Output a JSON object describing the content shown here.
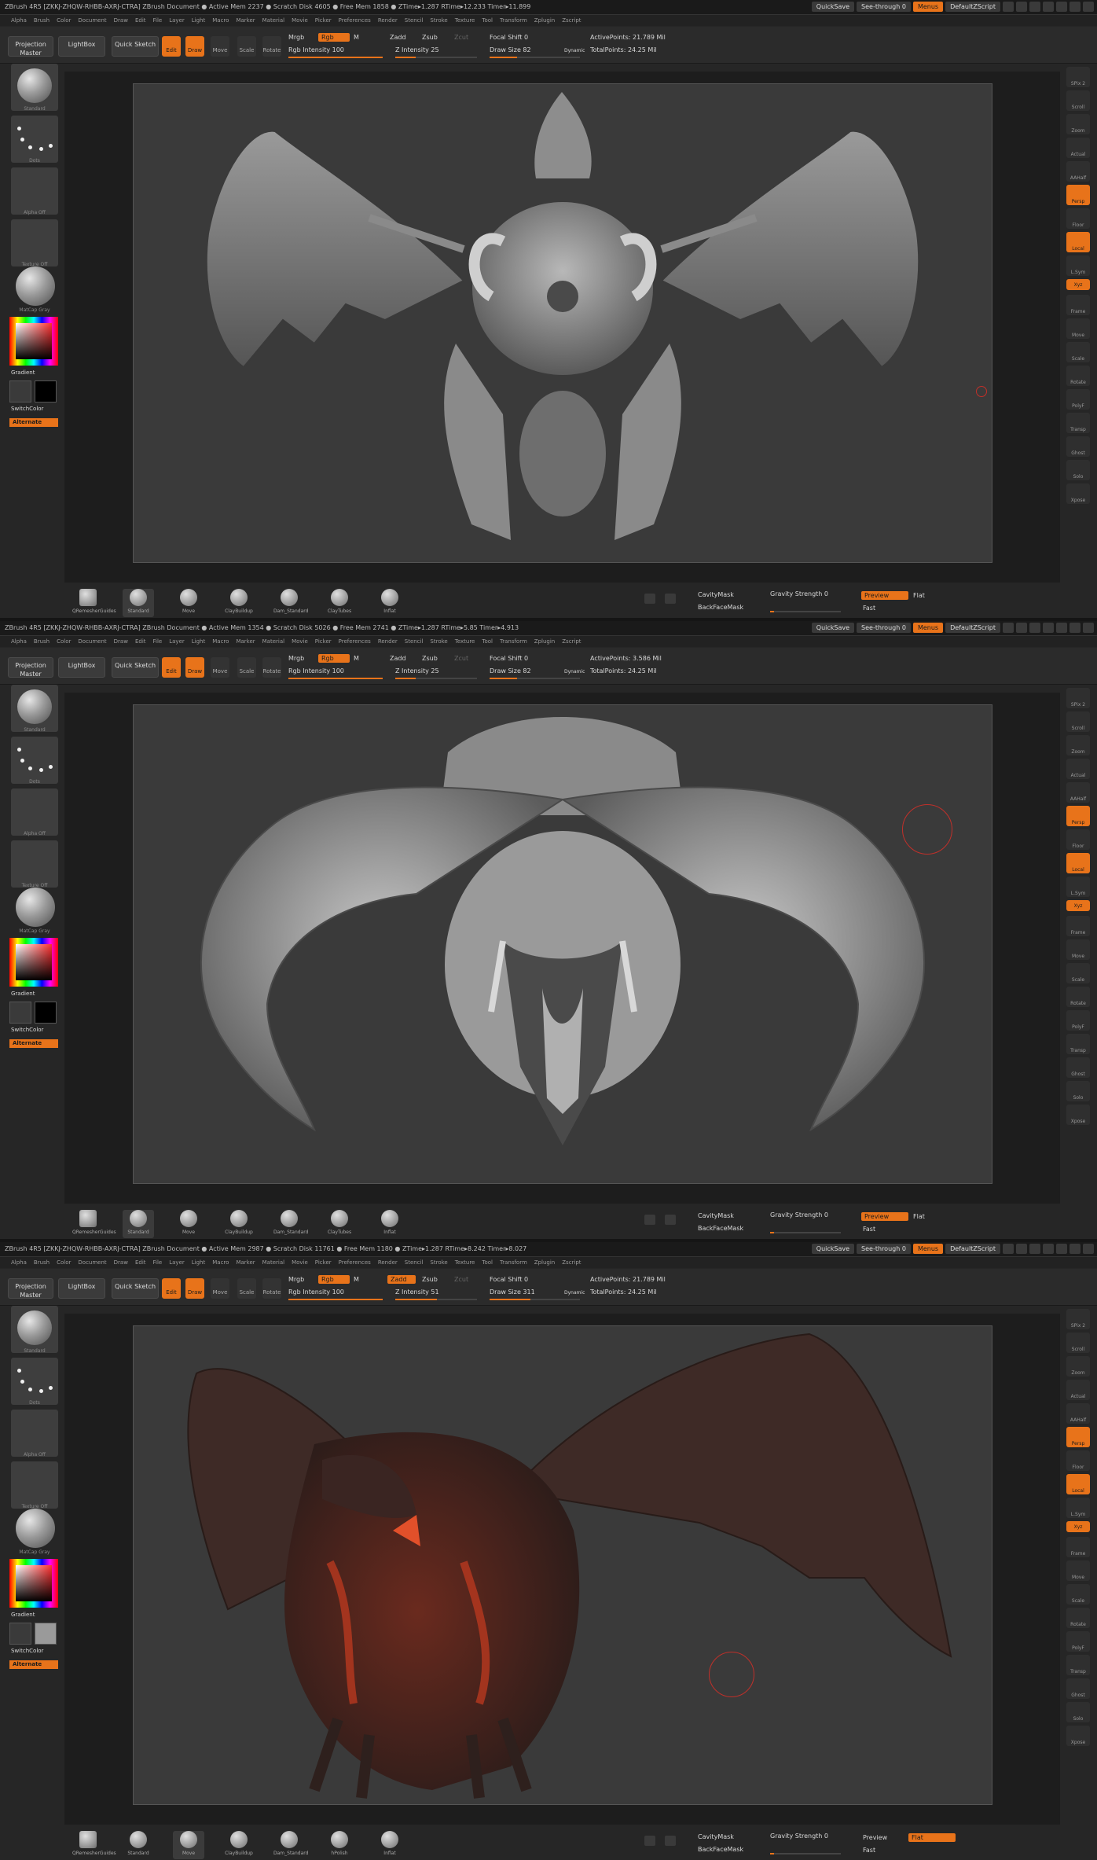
{
  "menus": [
    "Alpha",
    "Brush",
    "Color",
    "Document",
    "Draw",
    "Edit",
    "File",
    "Layer",
    "Light",
    "Macro",
    "Marker",
    "Material",
    "Movie",
    "Picker",
    "Preferences",
    "Render",
    "Stencil",
    "Stroke",
    "Texture",
    "Tool",
    "Transform",
    "Zplugin",
    "Zscript"
  ],
  "titlebar_buttons": {
    "quicksave": "QuickSave",
    "seethrough": "See-through",
    "seethrough_value": "0",
    "menus": "Menus",
    "script": "DefaultZScript"
  },
  "shelf": {
    "projection_master": "Projection Master",
    "lightbox": "LightBox",
    "quick_sketch": "Quick Sketch",
    "edit": "Edit",
    "draw": "Draw",
    "move": "Move",
    "scale": "Scale",
    "rotate": "Rotate",
    "mrgb": "Mrgb",
    "rgb": "Rgb",
    "m": "M",
    "zadd": "Zadd",
    "zsub": "Zsub",
    "zcut": "Zcut",
    "focal_shift": "Focal Shift 0",
    "dynamic": "Dynamic",
    "total_points": "TotalPoints: 24.25 Mil"
  },
  "left": {
    "material": "Standard",
    "stroke": "Dots",
    "alpha": "Alpha Off",
    "texture": "Texture Off",
    "matcap": "MatCap Gray",
    "gradient": "Gradient",
    "switchcolor": "SwitchColor",
    "alternate": "Alternate"
  },
  "right": [
    "SPix 2",
    "Scroll",
    "Zoom",
    "Actual",
    "AAHalf",
    "Persp",
    "Floor",
    "Local",
    "L.Sym",
    "Xyz",
    "Frame",
    "Move",
    "Scale",
    "Rotate",
    "PolyF",
    "Transp",
    "Ghost",
    "Solo",
    "Xpose"
  ],
  "bottom": {
    "cavity": "CavityMask",
    "backface": "BackFaceMask",
    "gravity": "Gravity Strength 0",
    "preview": "Preview",
    "flat": "Flat",
    "fast": "Fast"
  },
  "panels": [
    {
      "title": "ZBrush 4R5 [ZKKJ-ZHQW-RHBB-AXRJ-CTRA]    ZBrush Document    ● Active Mem 2237 ● Scratch Disk 4605 ● Free Mem 1858 ● ZTime▸1.287 RTime▸12.233 Timer▸11.899",
      "rgb_intensity": "Rgb Intensity 100",
      "z_intensity": "Z Intensity 25",
      "draw_size": "Draw Size 82",
      "active_points": "ActivePoints: 21.789 Mil",
      "brushes": [
        "QRemesherGuides",
        "Standard",
        "Move",
        "ClayBuildup",
        "Dam_Standard",
        "ClayTubes",
        "Inflat"
      ],
      "zadd_active": false,
      "preview_active": true
    },
    {
      "title": "ZBrush 4R5 [ZKKJ-ZHQW-RHBB-AXRJ-CTRA]    ZBrush Document    ● Active Mem 1354 ● Scratch Disk 5026 ● Free Mem 2741 ● ZTime▸1.287 RTime▸5.85 Timer▸4.913",
      "rgb_intensity": "Rgb Intensity 100",
      "z_intensity": "Z Intensity 25",
      "draw_size": "Draw Size 82",
      "active_points": "ActivePoints: 3.586 Mil",
      "brushes": [
        "QRemesherGuides",
        "Standard",
        "Move",
        "ClayBuildup",
        "Dam_Standard",
        "ClayTubes",
        "Inflat"
      ],
      "zadd_active": false,
      "preview_active": true
    },
    {
      "title": "ZBrush 4R5 [ZKKJ-ZHQW-RHBB-AXRJ-CTRA]    ZBrush Document    ● Active Mem 2987 ● Scratch Disk 11761 ● Free Mem 1180 ● ZTime▸1.287 RTime▸8.242 Timer▸8.027",
      "rgb_intensity": "Rgb Intensity 100",
      "z_intensity": "Z Intensity 51",
      "draw_size": "Draw Size 311",
      "active_points": "ActivePoints: 21.789 Mil",
      "brushes": [
        "QRemesherGuides",
        "Standard",
        "Move",
        "ClayBuildup",
        "Dam_Standard",
        "hPolish",
        "Inflat"
      ],
      "zadd_active": true,
      "preview_active": false
    }
  ],
  "colors": {
    "accent": "#e8731a",
    "background": "#262626",
    "document": "#3a3a3a",
    "cursor": "#c0302a"
  }
}
